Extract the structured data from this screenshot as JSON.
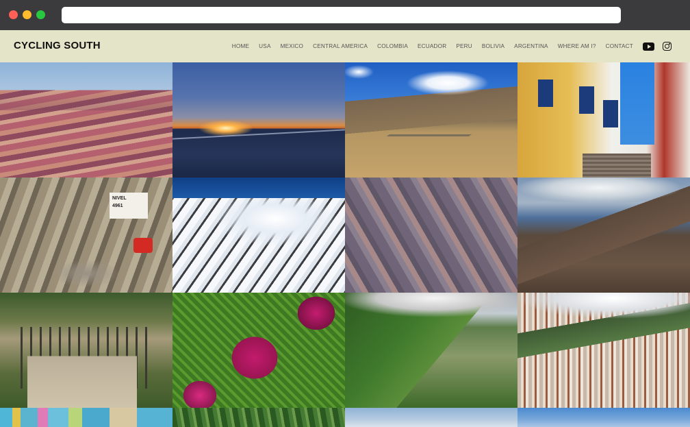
{
  "browser": {
    "url": ""
  },
  "site": {
    "brand": "CYCLING SOUTH",
    "nav": [
      {
        "label": "HOME"
      },
      {
        "label": "USA"
      },
      {
        "label": "MEXICO"
      },
      {
        "label": "CENTRAL AMERICA"
      },
      {
        "label": "COLOMBIA"
      },
      {
        "label": "ECUADOR"
      },
      {
        "label": "PERU"
      },
      {
        "label": "BOLIVIA"
      },
      {
        "label": "ARGENTINA"
      },
      {
        "label": "WHERE AM I?"
      },
      {
        "label": "CONTACT"
      }
    ],
    "social": [
      "youtube-icon",
      "instagram-icon"
    ]
  },
  "gallery": {
    "photos": [
      {
        "subject": "rainbow-mountains"
      },
      {
        "subject": "salt-flat-sunset"
      },
      {
        "subject": "railway-valley"
      },
      {
        "subject": "colonial-street"
      },
      {
        "subject": "cyclist-at-nivel-sign"
      },
      {
        "subject": "snowy-peaks"
      },
      {
        "subject": "eroded-canyon"
      },
      {
        "subject": "mountain-valley"
      },
      {
        "subject": "bailey-bridge"
      },
      {
        "subject": "coleus-leaf"
      },
      {
        "subject": "green-ridge"
      },
      {
        "subject": "city-panorama"
      },
      {
        "subject": "painted-wall"
      },
      {
        "subject": "forest"
      },
      {
        "subject": "sky"
      },
      {
        "subject": "sky"
      }
    ],
    "sign_text": "NIVEL 4961"
  }
}
